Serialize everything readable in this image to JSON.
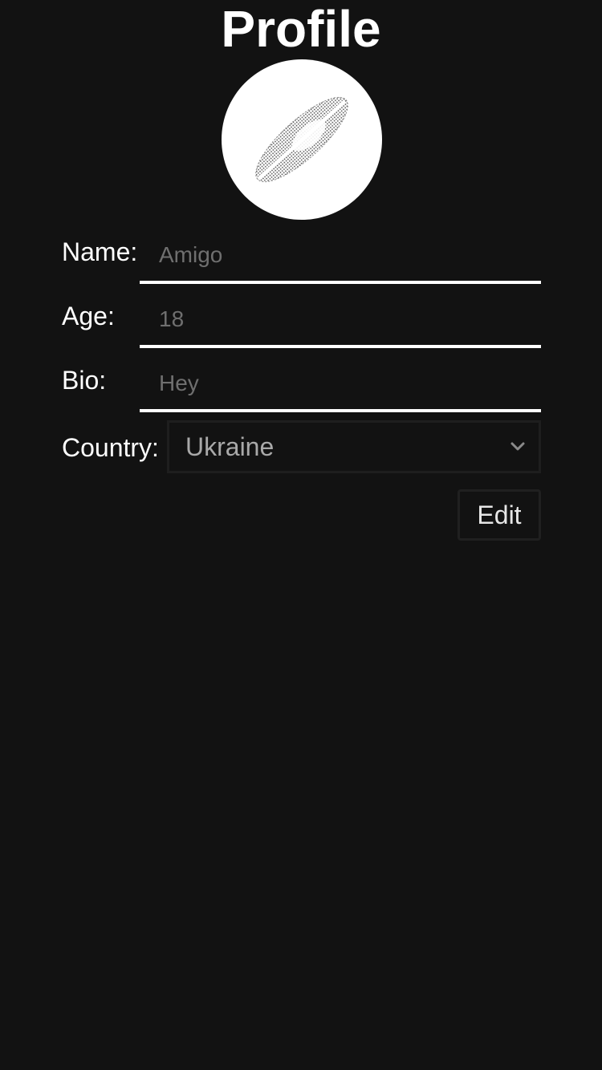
{
  "page": {
    "title": "Profile"
  },
  "avatar": {
    "icon": "leaf-icon"
  },
  "form": {
    "name": {
      "label": "Name:",
      "placeholder": "Amigo"
    },
    "age": {
      "label": "Age:",
      "placeholder": "18"
    },
    "bio": {
      "label": "Bio:",
      "placeholder": "Hey"
    },
    "country": {
      "label": "Country:",
      "selected": "Ukraine",
      "icon": "chevron-down-icon"
    },
    "edit_label": "Edit"
  },
  "colors": {
    "background": "#121212",
    "text": "#ffffff",
    "placeholder": "#6f6f6f",
    "select_text": "#a9a9a9",
    "border_dark": "#202020"
  }
}
